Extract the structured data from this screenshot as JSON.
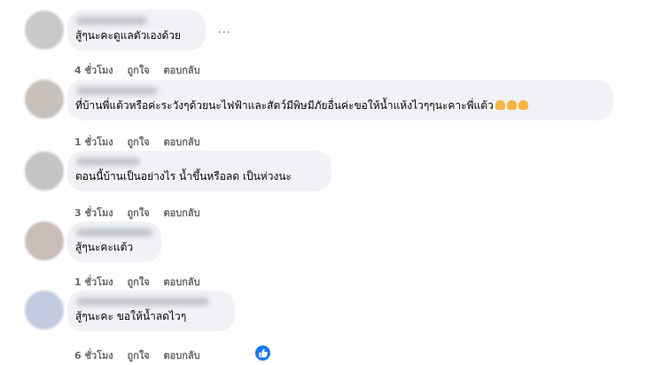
{
  "comments": [
    {
      "text": "สู้ๆนะคะดูแลตัวเองด้วย",
      "time": "4 ชั่วโมง",
      "like": "ถูกใจ",
      "reply": "ตอบกลับ",
      "more": "..."
    },
    {
      "text": "ที่บ้านพี่แต้วหรือค่ะระวังๆด้วยนะไฟฟ้าและสัตว์มีพิษมีภัยอื่นค่ะขอให้น้ำแห้งไวๆๆนะคาะพี่แต้ว",
      "time": "1 ชั่วโมง",
      "like": "ถูกใจ",
      "reply": "ตอบกลับ"
    },
    {
      "text": "ตอนนี้บ้านเป็นอย่างไร น้ำขึ้นหรือลด เป็นห่วงนะ",
      "time": "3 ชั่วโมง",
      "like": "ถูกใจ",
      "reply": "ตอบกลับ"
    },
    {
      "text": "สู้ๆนะคะแต้ว",
      "time": "1 ชั่วโมง",
      "like": "ถูกใจ",
      "reply": "ตอบกลับ"
    },
    {
      "text": "สู้ๆนะคะ ขอให้น้ำลดไวๆ",
      "time": "6 ชั่วโมง",
      "like": "ถูกใจ",
      "reply": "ตอบกลับ"
    }
  ],
  "icons": {
    "reaction_emoji": "folded-hands-icon",
    "like_reaction": "thumbs-up-icon"
  },
  "colors": {
    "bubble": "#f0f2f5",
    "meta_text": "#65676b",
    "like_blue": "#1877f2"
  }
}
